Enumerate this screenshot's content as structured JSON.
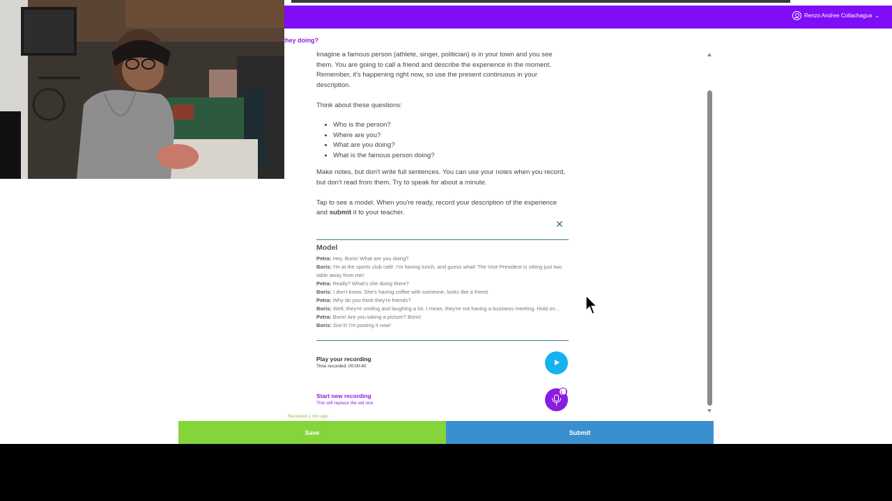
{
  "header": {
    "user_name": "Renzo Andree Collachagua",
    "chevron": "⌄",
    "user_icon": "user-circle-icon",
    "bg_color": "#7f0df5"
  },
  "section_title": "they doing?",
  "task": {
    "intro": "Imagine a famous person (athlete, singer, politician) is in your town and you see them. You are going to call a friend and describe the experience in the moment. Remember, it's happening right now, so use the present continuous in your description.",
    "think": "Think about these questions:",
    "questions": [
      "Who is the person?",
      "Where are you?",
      "What are you doing?",
      "What is the famous person doing?"
    ],
    "notes": "Make notes, but don't write full sentences. You can use your notes when you record, but don't read from them. Try to speak for about a minute.",
    "tap_before": "Tap to see a model. When you're ready, record your description of the experience and ",
    "tap_bold": "submit",
    "tap_after": " it to your teacher."
  },
  "close_symbol": "✕",
  "model": {
    "title": "Model",
    "lines": [
      {
        "speaker": "Petra:",
        "text": " Hey, Boris! What are you doing?"
      },
      {
        "speaker": "Boris:",
        "text": " I'm at the sports club café. I'm having lunch, and guess what! The Vice President is sitting just two table away from me!"
      },
      {
        "speaker": "Petra:",
        "text": " Really? What's she doing there?"
      },
      {
        "speaker": "Boris:",
        "text": " I don't know. She's having coffee with someone, looks like a friend."
      },
      {
        "speaker": "Petra:",
        "text": " Why do you think they're friends?"
      },
      {
        "speaker": "Boris:",
        "text": " Well, they're smiling and laughing a lot. I mean, they're not having a business meeting. Hold on..."
      },
      {
        "speaker": "Petra:",
        "text": " Boris! Are you taking a picture? Boris!"
      },
      {
        "speaker": "Boris:",
        "text": " Got it! I'm posting it now!"
      }
    ]
  },
  "playback": {
    "label": "Play your recording",
    "time": "Time recorded: 00:00:40",
    "icon": "play-icon",
    "color": "#14b3f0"
  },
  "new_recording": {
    "label": "Start new recording",
    "sub": "This will replace the old one",
    "icon": "microphone-icon",
    "color": "#8c1cde"
  },
  "recorded_note": "Recorded 1 min ago",
  "buttons": {
    "save": "Save",
    "submit": "Submit",
    "save_color": "#84d43a",
    "submit_color": "#3a8fcf"
  }
}
